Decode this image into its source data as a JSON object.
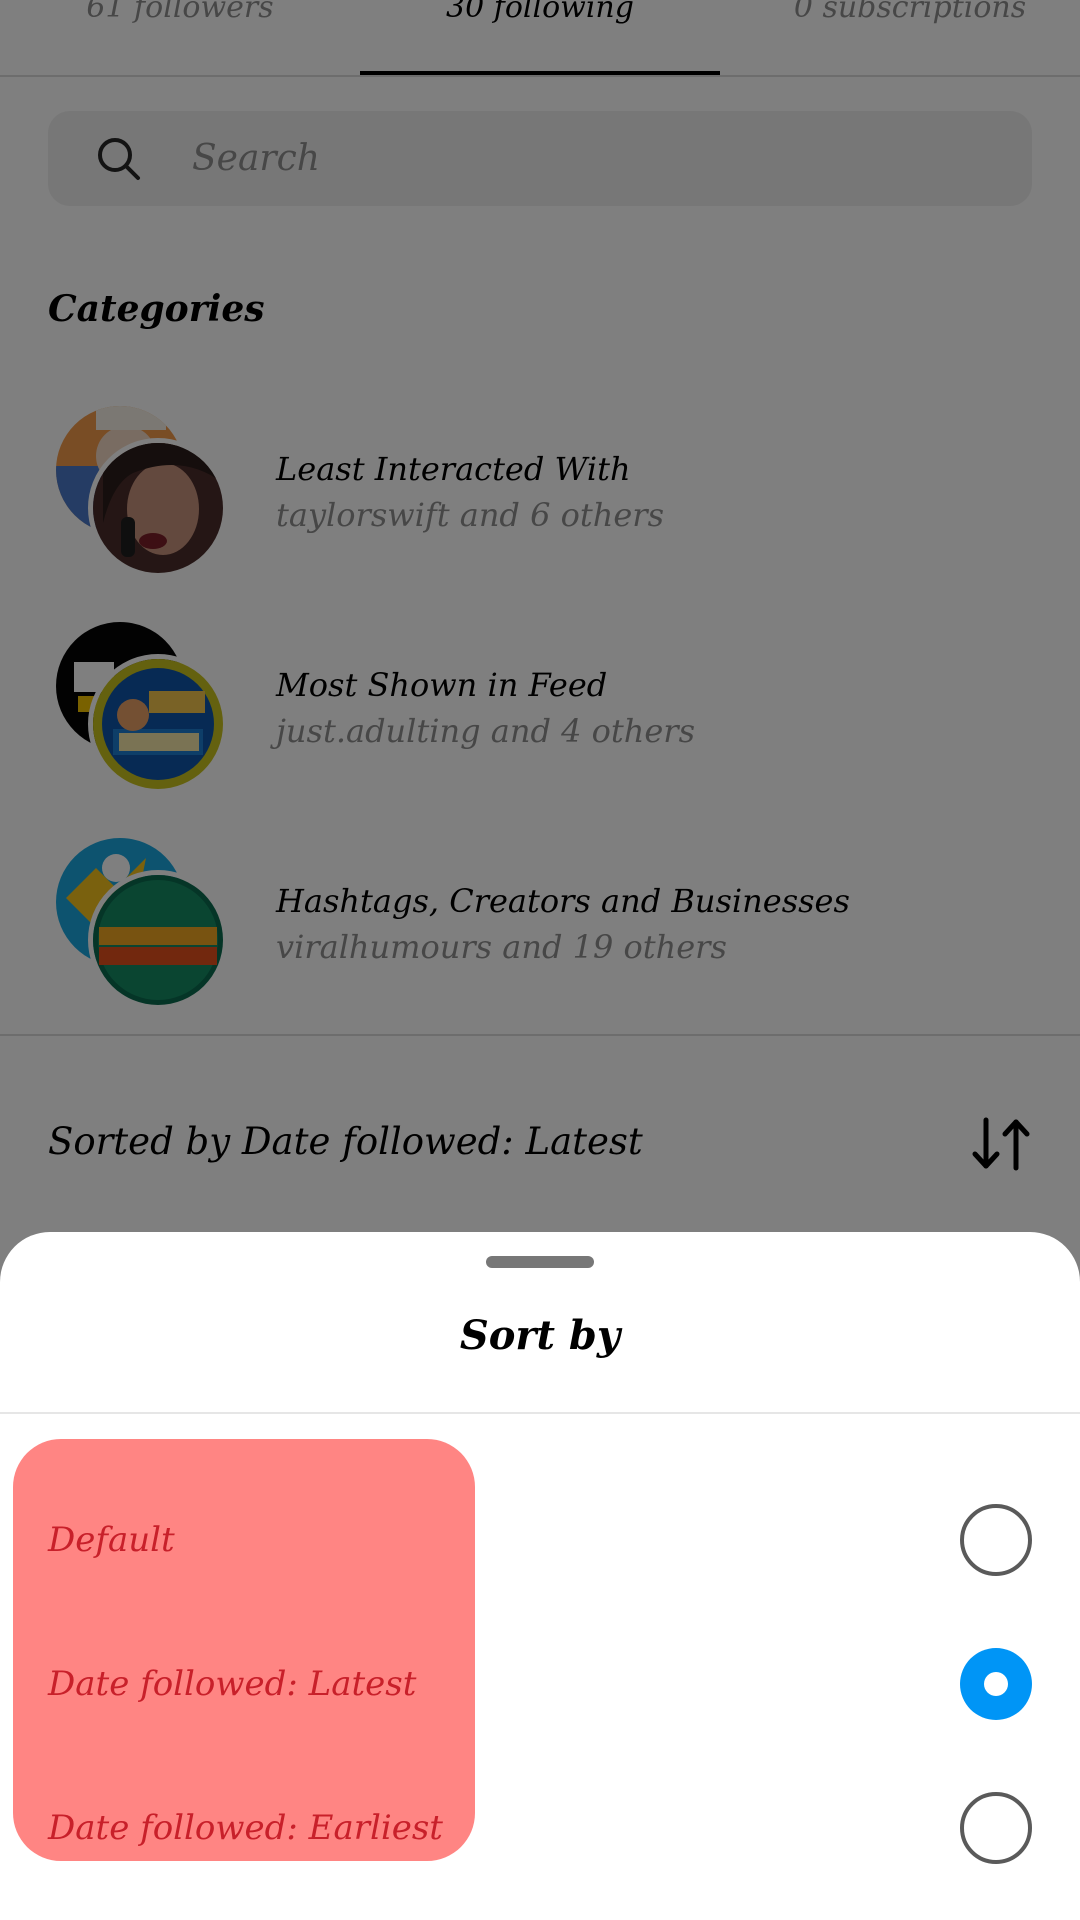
{
  "tabs": [
    {
      "label": "61 followers"
    },
    {
      "label": "30 following"
    },
    {
      "label": "0 subscriptions"
    }
  ],
  "search": {
    "placeholder": "Search"
  },
  "categories": {
    "title": "Categories",
    "items": [
      {
        "title": "Least Interacted With",
        "subtitle": "taylorswift and 6 others"
      },
      {
        "title": "Most Shown in Feed",
        "subtitle": "just.adulting and 4 others"
      },
      {
        "title": "Hashtags, Creators and Businesses",
        "subtitle": "viralhumours and 19 others"
      }
    ]
  },
  "sorted_by": "Sorted by Date followed: Latest",
  "sheet": {
    "title": "Sort by",
    "options": [
      {
        "label": "Default",
        "selected": false
      },
      {
        "label": "Date followed: Latest",
        "selected": true
      },
      {
        "label": "Date followed: Earliest",
        "selected": false
      }
    ]
  },
  "colors": {
    "accent": "#0095f6",
    "highlight": "#ff8583",
    "option_text": "#c8202a"
  }
}
